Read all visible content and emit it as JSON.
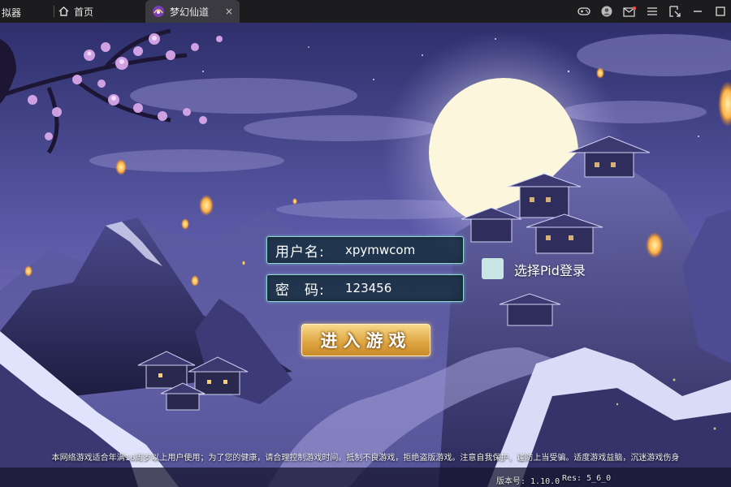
{
  "titlebar": {
    "app_name": "拟器",
    "tabs": [
      {
        "label": "首页",
        "icon": "home-icon"
      },
      {
        "label": "梦幻仙道",
        "icon": "game-logo-icon",
        "close": "×"
      }
    ],
    "right_icons": [
      "gamepad-icon",
      "user-avatar-icon",
      "mail-icon",
      "menu-icon",
      "screen-capture-icon",
      "minimize-icon",
      "maximize-icon"
    ]
  },
  "login": {
    "username_label": "用户名:",
    "username_value": "xpymwcom",
    "password_label": "密　码:",
    "password_value": "123456",
    "pid_label": "选择Pid登录",
    "enter_button": "进入游戏"
  },
  "footer": {
    "notice": "本网络游戏适合年满16周岁以上用户使用；为了您的健康，请合理控制游戏时间。抵制不良游戏，拒绝盗版游戏。注意自我保护，谨防上当受骗。适度游戏益脑，沉迷游戏伤身",
    "version": "版本号: 1.10.0",
    "res": "Res: 5_6_0"
  },
  "colors": {
    "titlebar_bg": "#1c1c1f",
    "field_border": "#8fd6d6",
    "button_gold": "#e0a845"
  }
}
